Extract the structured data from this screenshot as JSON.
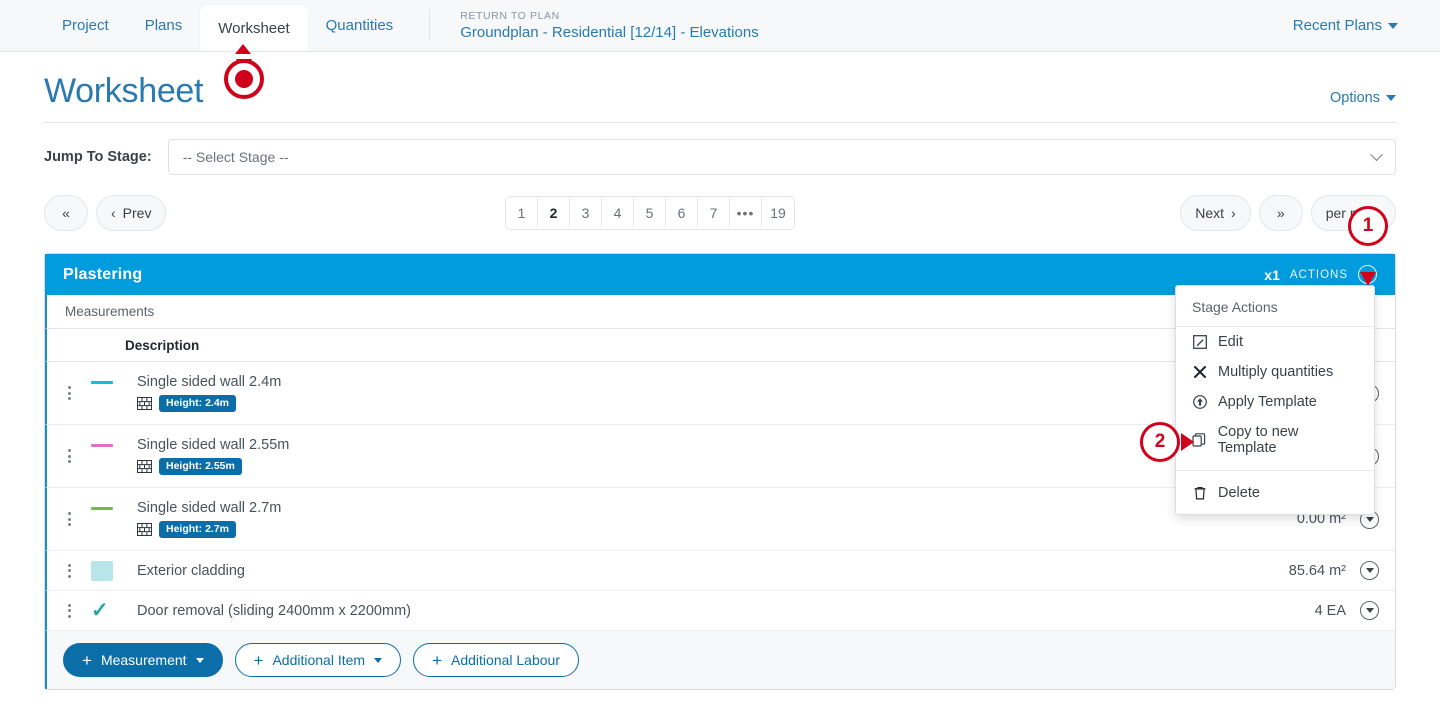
{
  "nav": {
    "tabs": [
      {
        "label": "Project",
        "active": false
      },
      {
        "label": "Plans",
        "active": false
      },
      {
        "label": "Worksheet",
        "active": true
      },
      {
        "label": "Quantities",
        "active": false
      }
    ],
    "plan_kicker": "RETURN TO PLAN",
    "plan_name": "Groundplan - Residential [12/14] - Elevations",
    "recent_plans": "Recent Plans"
  },
  "page": {
    "title": "Worksheet",
    "options_label": "Options"
  },
  "stage_jump": {
    "label": "Jump To Stage:",
    "selected": "-- Select Stage --"
  },
  "pagination": {
    "first_icon": "«",
    "prev_label": "Prev",
    "prev_icon": "‹",
    "pages": [
      "1",
      "2",
      "3",
      "4",
      "5",
      "6",
      "7",
      "•••",
      "19"
    ],
    "active_page": "2",
    "next_label": "Next",
    "next_icon": "›",
    "last_icon": "»",
    "per_page_label": "per page"
  },
  "stage_card": {
    "title": "Plastering",
    "multiplier": "x1",
    "actions_label": "ACTIONS",
    "measurements_label": "Measurements",
    "column_description": "Description",
    "rows": [
      {
        "description": "Single sided wall 2.4m",
        "swatch_type": "line",
        "swatch_color": "#1cb7e8",
        "badge": "Height: 2.4m",
        "badge_icon": "brick-icon",
        "quantity": ""
      },
      {
        "description": "Single sided wall 2.55m",
        "swatch_type": "line",
        "swatch_color": "#e06ec8",
        "badge": "Height: 2.55m",
        "badge_icon": "brick-icon",
        "quantity": ""
      },
      {
        "description": "Single sided wall 2.7m",
        "swatch_type": "line",
        "swatch_color": "#6cc04a",
        "badge": "Height: 2.7m",
        "badge_icon": "brick-icon",
        "quantity": "0.00 m²"
      },
      {
        "description": "Exterior cladding",
        "swatch_type": "box",
        "swatch_color": "#b8e4ea",
        "badge": "",
        "quantity": "85.64 m²"
      },
      {
        "description": "Door removal (sliding 2400mm x 2200mm)",
        "swatch_type": "check",
        "swatch_color": "#2ba3a8",
        "badge": "",
        "quantity": "4 EA"
      }
    ],
    "footer_buttons": [
      {
        "label": "Measurement",
        "primary": true,
        "has_caret": true
      },
      {
        "label": "Additional Item",
        "primary": false,
        "has_caret": true
      },
      {
        "label": "Additional Labour",
        "primary": false,
        "has_caret": false
      }
    ]
  },
  "dropdown": {
    "title": "Stage Actions",
    "items": [
      {
        "label": "Edit",
        "icon": "edit-pencil-icon"
      },
      {
        "label": "Multiply quantities",
        "icon": "multiply-x-icon"
      },
      {
        "label": "Apply Template",
        "icon": "apply-template-icon"
      },
      {
        "label": "Copy to new Template",
        "icon": "copy-icon"
      },
      {
        "label": "Delete",
        "icon": "trash-icon"
      }
    ]
  },
  "annotations": [
    {
      "number": "1"
    },
    {
      "number": "2"
    }
  ],
  "colors": {
    "brand_blue": "#009cde",
    "link_blue": "#2a7ab0",
    "button_blue": "#0b6ea8",
    "annotation_red": "#d0021b"
  }
}
